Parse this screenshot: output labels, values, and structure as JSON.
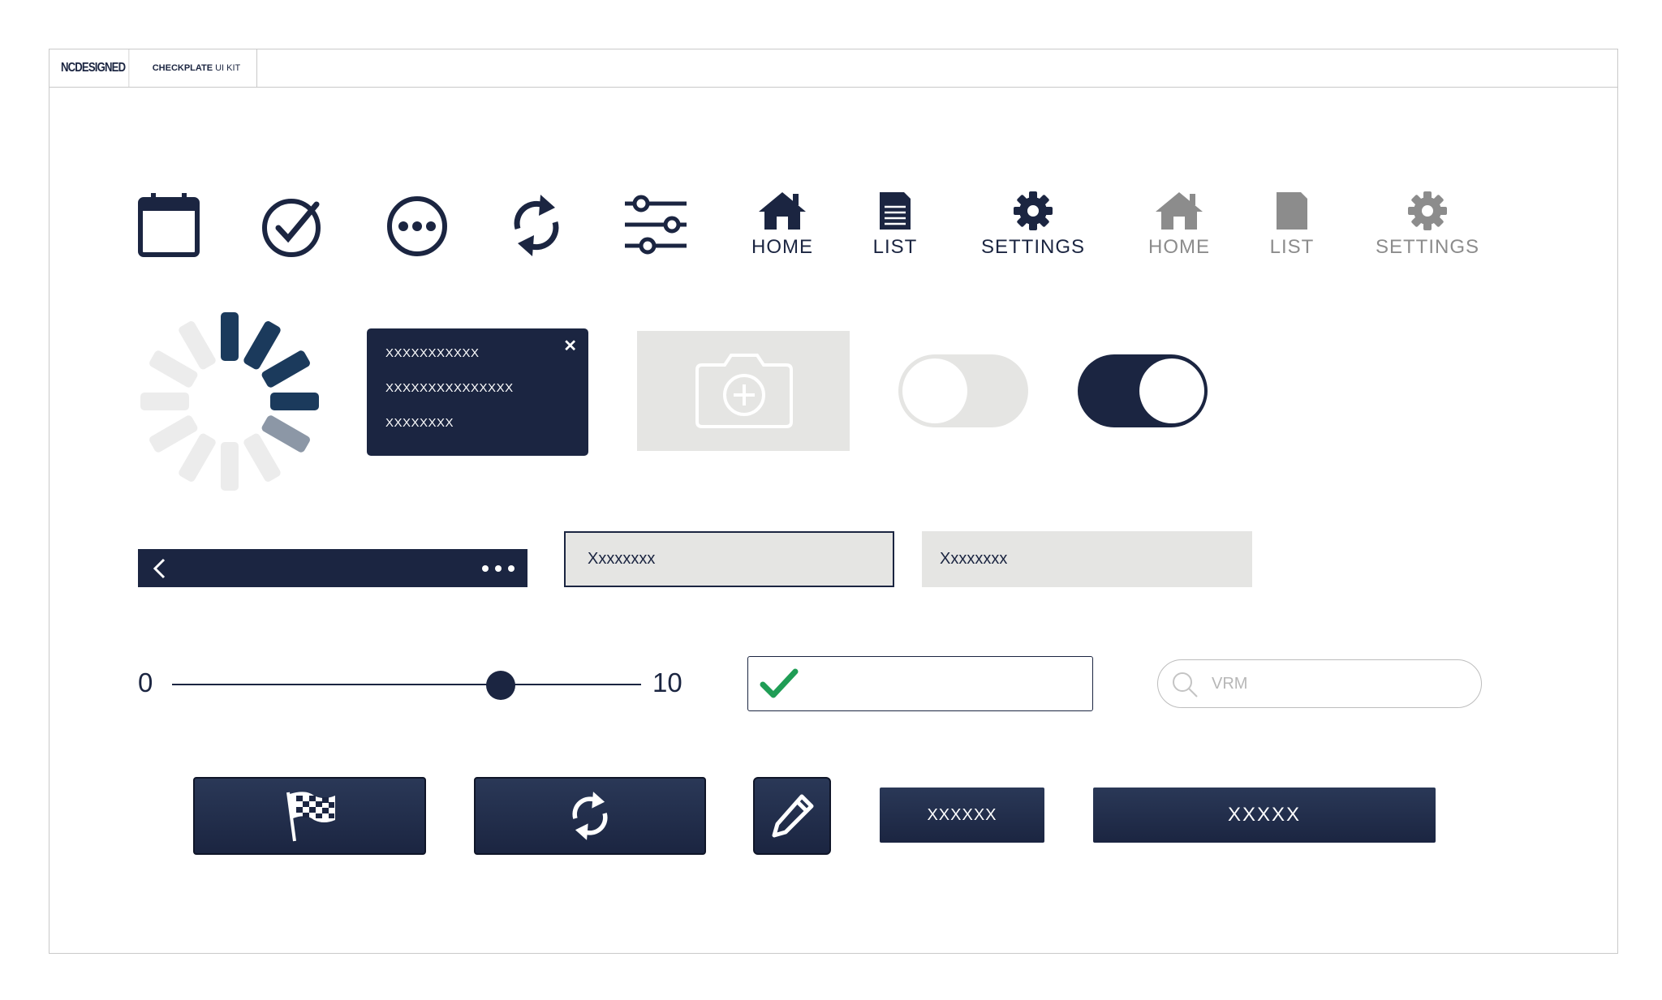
{
  "header": {
    "brand": "NCDESIGNED",
    "kit_bold": "CHECKPLATE",
    "kit_rest": "UI KIT"
  },
  "icons_row": {
    "icons": [
      "calendar-icon",
      "check-circle-icon",
      "more-circle-icon",
      "refresh-icon",
      "sliders-icon"
    ],
    "nav_active": [
      {
        "icon": "home-icon",
        "label": "HOME"
      },
      {
        "icon": "list-icon",
        "label": "LIST"
      },
      {
        "icon": "gear-icon",
        "label": "SETTINGS"
      }
    ],
    "nav_inactive": [
      {
        "icon": "home-icon",
        "label": "HOME"
      },
      {
        "icon": "list-icon",
        "label": "LIST"
      },
      {
        "icon": "gear-icon",
        "label": "SETTINGS"
      }
    ]
  },
  "popup": {
    "lines": [
      "XXXXXXXXXXX",
      "XXXXXXXXXXXXXXX",
      "XXXXXXXX"
    ],
    "close": "✕"
  },
  "toggles": {
    "off": false,
    "on": true
  },
  "toolbar": {
    "back_icon": "chevron-left-icon",
    "more_icon": "more-horizontal-icon"
  },
  "inputs": {
    "outlined_value": "Xxxxxxxx",
    "filled_value": "Xxxxxxxx"
  },
  "slider": {
    "min": "0",
    "max": "10",
    "value": 7
  },
  "check_input": {
    "icon": "checkmark-icon"
  },
  "search": {
    "placeholder": "VRM"
  },
  "buttons": {
    "small_label": "XXXXXX",
    "wide_label": "XXXXX"
  },
  "colors": {
    "primary": "#1b2541",
    "inactive": "#8c8c8c",
    "light_gray": "#e5e5e3",
    "success": "#1f9d55"
  }
}
